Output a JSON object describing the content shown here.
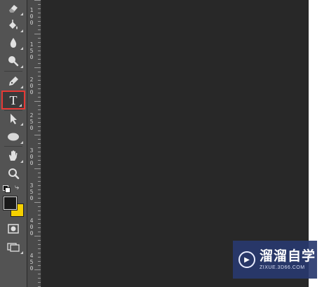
{
  "toolbar": {
    "tools": [
      {
        "name": "eraser-tool",
        "icon": "eraser-icon"
      },
      {
        "name": "paint-bucket-tool",
        "icon": "paint-bucket-icon"
      },
      {
        "name": "blur-tool",
        "icon": "droplet-icon"
      },
      {
        "name": "dodge-tool",
        "icon": "dodge-icon"
      },
      {
        "name": "pen-tool",
        "icon": "pen-icon"
      },
      {
        "name": "type-tool",
        "icon": "type-icon",
        "glyph": "T",
        "selected": true
      },
      {
        "name": "path-selection-tool",
        "icon": "arrow-icon"
      },
      {
        "name": "ellipse-tool",
        "icon": "ellipse-icon"
      },
      {
        "name": "hand-tool",
        "icon": "hand-icon"
      },
      {
        "name": "zoom-tool",
        "icon": "magnifier-icon"
      }
    ],
    "foreground_color": "#1a1a1a",
    "background_color": "#f5d000",
    "highlight_color": "#e53935"
  },
  "ruler": {
    "labels": [
      "100",
      "150",
      "200",
      "250",
      "300",
      "350",
      "400",
      "450"
    ]
  },
  "watermark": {
    "title": "溜溜自学",
    "subtitle": "ZIXUE.3D66.COM"
  }
}
